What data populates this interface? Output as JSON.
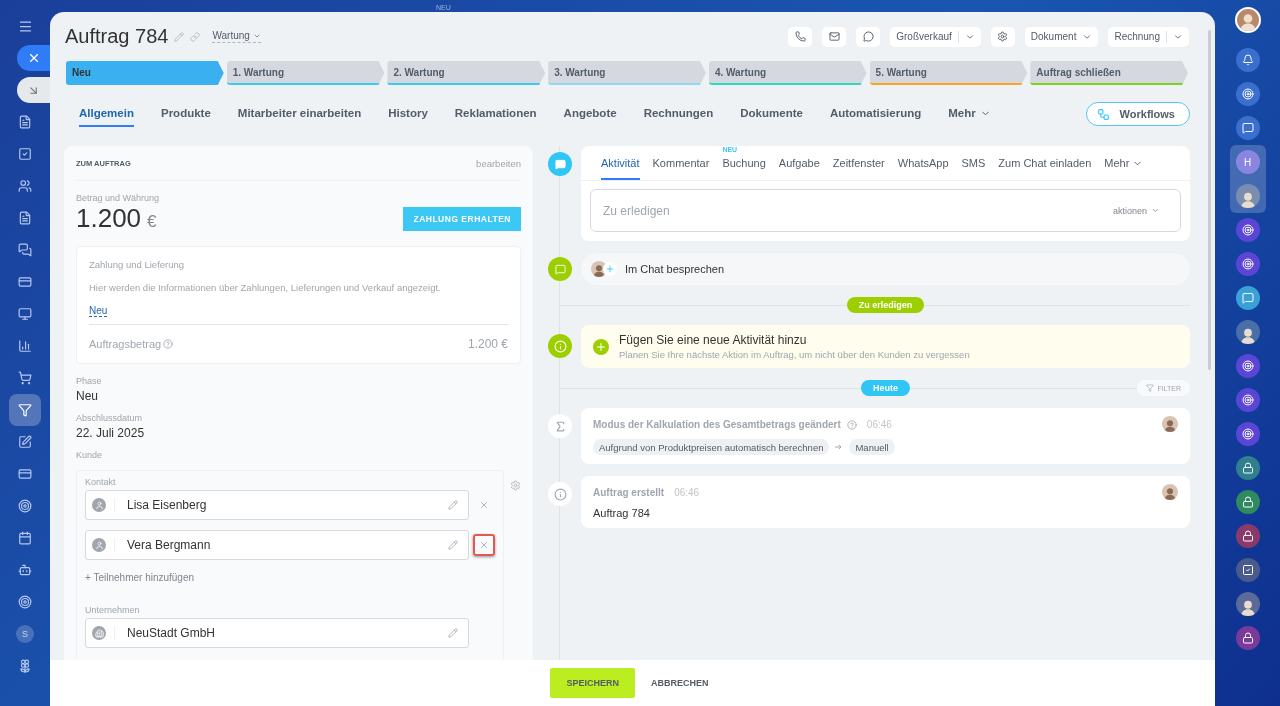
{
  "background_badge": "NEU",
  "left_rail": {
    "items": [
      {
        "kind": "doc",
        "selected": false
      },
      {
        "kind": "check",
        "selected": false
      },
      {
        "kind": "users",
        "selected": false
      },
      {
        "kind": "doc",
        "selected": false
      },
      {
        "kind": "chat",
        "selected": false
      },
      {
        "kind": "card",
        "selected": false
      },
      {
        "kind": "monitor",
        "selected": false
      },
      {
        "kind": "chart",
        "selected": false
      },
      {
        "kind": "cart",
        "selected": false
      },
      {
        "kind": "funnel",
        "selected": true
      },
      {
        "kind": "edit",
        "selected": false
      },
      {
        "kind": "card",
        "selected": false
      },
      {
        "kind": "target",
        "selected": false
      },
      {
        "kind": "calendar",
        "selected": false
      },
      {
        "kind": "bot",
        "selected": false
      },
      {
        "kind": "target",
        "selected": false
      }
    ],
    "user_initial": "S"
  },
  "header": {
    "title": "Auftrag 784",
    "pipeline": "Wartung",
    "actions": [
      {
        "kind": "phone"
      },
      {
        "kind": "mail"
      },
      {
        "kind": "chat"
      },
      {
        "kind": "split",
        "label": "Großverkauf"
      },
      {
        "kind": "gear"
      },
      {
        "kind": "dropdown",
        "label": "Dokument"
      },
      {
        "kind": "split",
        "label": "Rechnung"
      }
    ]
  },
  "stages": [
    {
      "label": "Neu",
      "color": "#3bb0f0",
      "selected": true
    },
    {
      "label": "1. Wartung",
      "color": "#3fc8f0",
      "selected": false
    },
    {
      "label": "2. Wartung",
      "color": "#3fc8f0",
      "selected": false
    },
    {
      "label": "3. Wartung",
      "color": "#8fd8f5",
      "selected": false
    },
    {
      "label": "4. Wartung",
      "color": "#2fd9c0",
      "selected": false
    },
    {
      "label": "5. Wartung",
      "color": "#f5a623",
      "selected": false
    },
    {
      "label": "Auftrag schließen",
      "color": "#7ed321",
      "selected": false
    }
  ],
  "tabs": [
    {
      "label": "Allgemein",
      "kind": "tab",
      "selected": true
    },
    {
      "label": "Produkte",
      "kind": "tab",
      "selected": false
    },
    {
      "label": "Mitarbeiter einarbeiten",
      "kind": "tab",
      "selected": false
    },
    {
      "label": "History",
      "kind": "tab",
      "selected": false
    },
    {
      "label": "Reklamationen",
      "kind": "tab",
      "selected": false
    },
    {
      "label": "Angebote",
      "kind": "tab",
      "selected": false
    },
    {
      "label": "Rechnungen",
      "kind": "tab",
      "selected": false
    },
    {
      "label": "Dokumente",
      "kind": "tab",
      "selected": false
    },
    {
      "label": "Automatisierung",
      "kind": "tab",
      "selected": false
    },
    {
      "label": "Mehr",
      "kind": "menu",
      "selected": false
    }
  ],
  "workflows_button": "Workflows",
  "order_card": {
    "title": "ZUM AUFTRAG",
    "edit_link": "bearbeiten",
    "amount_label": "Betrag und Währung",
    "amount": "1.200",
    "currency": "€",
    "pay_button": "ZAHLUNG ERHALTEN",
    "payment_box": {
      "title": "Zahlung und Lieferung",
      "text": "Hier werden die Informationen über Zahlungen, Lieferungen und Verkauf angezeigt.",
      "link": "Neu",
      "total_label": "Auftragsbetrag",
      "total": "1.200 €"
    },
    "fields": [
      {
        "label": "Phase",
        "value": "Neu"
      },
      {
        "label": "Abschlussdatum",
        "value": "22. Juli 2025"
      }
    ],
    "customer": {
      "label": "Kunde",
      "contact_label": "Kontakt",
      "contacts": [
        {
          "name": "Lisa Eisenberg",
          "highlighted": false
        },
        {
          "name": "Vera Bergmann",
          "highlighted": true
        }
      ],
      "add_link": "+ Teilnehmer hinzufügen",
      "company_label": "Unternehmen",
      "company": "NeuStadt GmbH"
    }
  },
  "timeline": {
    "composer": {
      "tabs": [
        {
          "label": "Aktivität",
          "kind": "tab",
          "selected": true
        },
        {
          "label": "Kommentar",
          "kind": "tab",
          "selected": false
        },
        {
          "label": "Buchung",
          "kind": "tab",
          "selected": false,
          "badge": "NEU"
        },
        {
          "label": "Aufgabe",
          "kind": "tab",
          "selected": false
        },
        {
          "label": "Zeitfenster",
          "kind": "tab",
          "selected": false
        },
        {
          "label": "WhatsApp",
          "kind": "tab",
          "selected": false
        },
        {
          "label": "SMS",
          "kind": "tab",
          "selected": false
        },
        {
          "label": "Zum Chat einladen",
          "kind": "tab",
          "selected": false
        },
        {
          "label": "Mehr",
          "kind": "menu",
          "selected": false
        }
      ],
      "placeholder": "Zu erledigen",
      "actions": "aktionen"
    },
    "chat": "Im Chat besprechen",
    "todo_badge": "Zu erledigen",
    "suggestion": {
      "title": "Fügen Sie eine neue Aktivität hinzu",
      "text": "Planen Sie Ihre nächste Aktion im Auftrag, um nicht über den Kunden zu vergessen"
    },
    "today_badge": "Heute",
    "filter": "FILTER",
    "events": [
      {
        "kind": "sum",
        "title": "Modus der Kalkulation des Gesamtbetrags geändert",
        "time": "06:46",
        "from": "Aufgrund von Produktpreisen automatisch berechnen",
        "to": "Manuell"
      },
      {
        "kind": "info",
        "title": "Auftrag erstellt",
        "time": "06:46",
        "text": "Auftrag 784"
      }
    ]
  },
  "footer": {
    "save": "SPEICHERN",
    "cancel": "ABBRECHEN"
  },
  "right_rail": {
    "items": [
      {
        "kind": "bell",
        "selected": false,
        "color": "#3a6fd0"
      },
      {
        "kind": "target",
        "selected": false,
        "color": "#3a6fd0"
      },
      {
        "kind": "chat",
        "selected": false,
        "color": "#3a6fd0"
      },
      {
        "kind": "letter",
        "letter": "H",
        "selected": true,
        "color": "#8a86e0"
      },
      {
        "kind": "avatar",
        "selected": true,
        "color": "#7a8fb0"
      },
      {
        "kind": "target",
        "selected": false,
        "color": "#5b45d6"
      },
      {
        "kind": "target",
        "selected": false,
        "color": "#5b45d6"
      },
      {
        "kind": "chat",
        "selected": false,
        "color": "#3aa0d8"
      },
      {
        "kind": "avatar",
        "selected": false,
        "color": "#4a6fa8"
      },
      {
        "kind": "target",
        "selected": false,
        "color": "#5b45d6"
      },
      {
        "kind": "target",
        "selected": false,
        "color": "#5b45d6"
      },
      {
        "kind": "target",
        "selected": false,
        "color": "#5b45d6"
      },
      {
        "kind": "lock",
        "selected": false,
        "color": "#2f7f8f"
      },
      {
        "kind": "lock",
        "selected": false,
        "color": "#2f8a5f"
      },
      {
        "kind": "lock",
        "selected": false,
        "color": "#8a3a6a"
      },
      {
        "kind": "check",
        "selected": false,
        "color": "#4a5a8a"
      },
      {
        "kind": "avatar",
        "selected": false,
        "color": "#5a6a9a"
      },
      {
        "kind": "lock",
        "selected": false,
        "color": "#7a3a9a"
      }
    ]
  }
}
